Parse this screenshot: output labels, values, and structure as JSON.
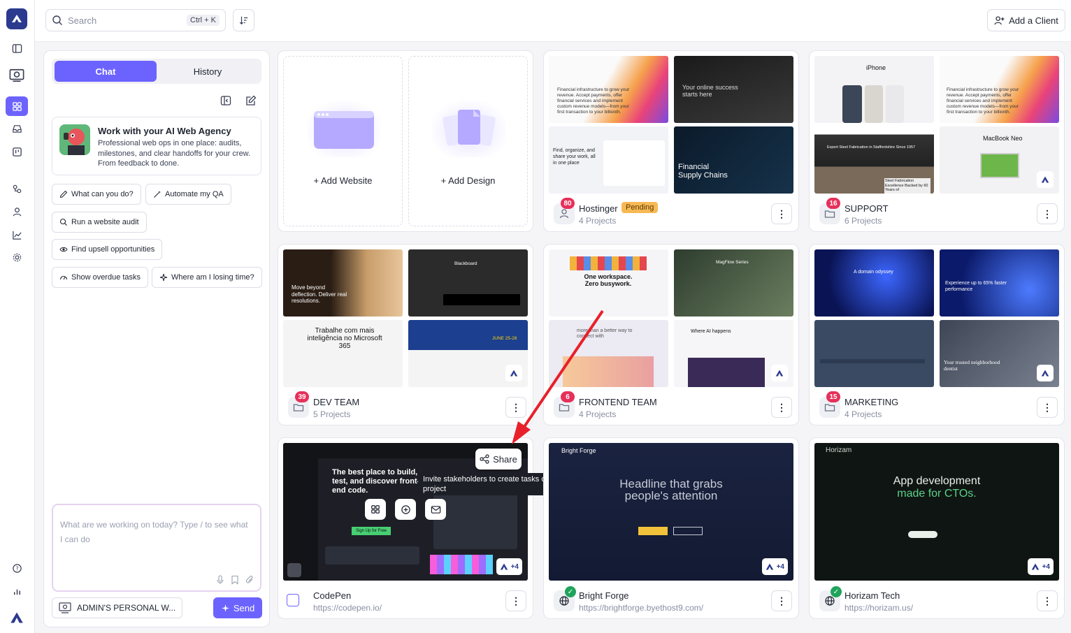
{
  "topbar": {
    "search_placeholder": "Search",
    "search_shortcut": "Ctrl + K",
    "add_client_label": "Add a Client"
  },
  "chat": {
    "tab_chat": "Chat",
    "tab_history": "History",
    "intro_title": "Work with your AI Web Agency",
    "intro_desc": "Professional web ops in one place: audits, milestones, and clear handoffs for your crew. From feedback to done.",
    "chips": [
      "What can you do?",
      "Automate my QA",
      "Run a website audit",
      "Find upsell opportunities",
      "Show overdue tasks",
      "Where am I losing time?"
    ],
    "input_placeholder": "What are we working on today? Type / to see what I can do",
    "workspace_label": "ADMIN'S PERSONAL W...",
    "send_label": "Send"
  },
  "add_tiles": {
    "website": "+ Add Website",
    "design": "+ Add Design"
  },
  "cards": {
    "hostinger": {
      "name": "Hostinger",
      "status": "Pending",
      "sub": "4 Projects",
      "badge": "80",
      "t1": "Financial infrastructure to grow your revenue. Accept payments, offer financial services and implement custom revenue models—from your first transaction to your billionth.",
      "t2": "Your online success starts here",
      "t3": "Find, organize, and share your work, all in one place",
      "t4": "Financial Supply Chains"
    },
    "support": {
      "name": "SUPPORT",
      "sub": "6 Projects",
      "badge": "16",
      "t1": "iPhone",
      "t2": "Financial infrastructure to grow your revenue. Accept payments, offer financial services and implement custom revenue models—from your first transaction to your billionth.",
      "t3": "Expert Steel Fabrication in Staffordshire Since 1957",
      "t3b": "Steel Fabrication Excellence Backed by 60 Years of",
      "t4": "MacBook Neo"
    },
    "devteam": {
      "name": "DEV TEAM",
      "sub": "5 Projects",
      "badge": "39",
      "t1": "Move beyond deflection. Deliver real resolutions.",
      "t2": "Blackboard",
      "t3": "Trabalhe com mais inteligência no Microsoft 365",
      "t4": "JUNE 25-28"
    },
    "frontend": {
      "name": "FRONTEND TEAM",
      "sub": "4 Projects",
      "badge": "6",
      "t1": "One workspace. Zero busywork.",
      "t2": "MagFlow Series",
      "t3": "more than a better way to connect with",
      "t4": "Where AI happens"
    },
    "marketing": {
      "name": "MARKETING",
      "sub": "4 Projects",
      "badge": "15",
      "t1": "A domain odyssey",
      "t2": "Experience up to 65% faster performance",
      "t3": "",
      "t4": "Your trusted neighborhood dentist"
    },
    "codepen": {
      "name": "CodePen",
      "sub": "https://codepen.io/",
      "headline": "The best place to build, test, and discover front-end code.",
      "cta": "Sign Up for Free",
      "share": "Share",
      "tooltip": "Invite stakeholders to create tasks on this project",
      "plus": "+4"
    },
    "brightforge": {
      "name": "Bright Forge",
      "sub": "https://brightforge.byethost9.com/",
      "brand": "Bright Forge",
      "headline": "Headline that grabs people's attention",
      "plus": "+4"
    },
    "horizam": {
      "name": "Horizam Tech",
      "sub": "https://horizam.us/",
      "brand": "Horizam",
      "headline1": "App development",
      "headline2": "made for CTOs.",
      "plus": "+4"
    }
  },
  "colors": {
    "accent": "#6c63ff",
    "badge": "#e6305a",
    "pending": "#f7b955",
    "online": "#1fa45a"
  }
}
